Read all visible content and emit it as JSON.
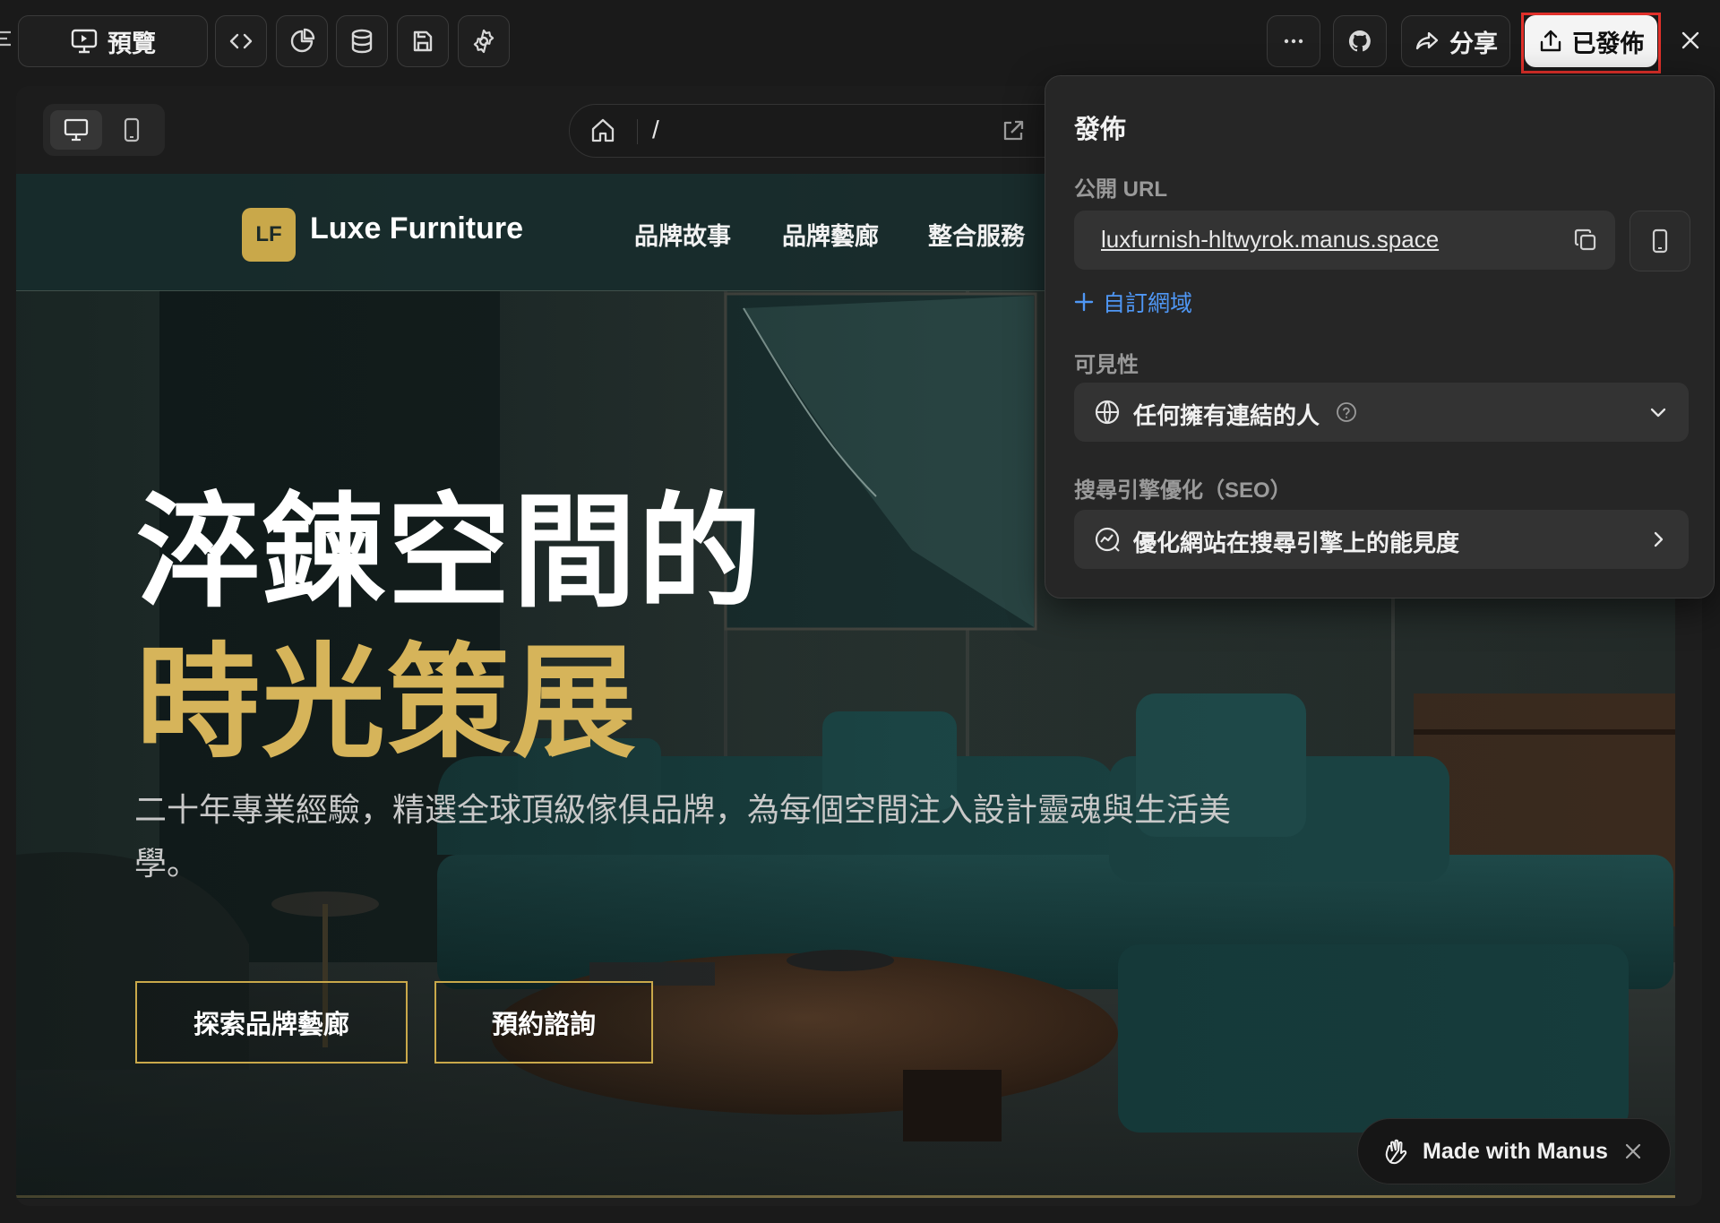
{
  "toolbar": {
    "preview_label": "預覽",
    "share_label": "分享",
    "published_label": "已發佈"
  },
  "browser": {
    "path": "/"
  },
  "site": {
    "logo": "LF",
    "brand": "Luxe Furniture",
    "nav": [
      "品牌故事",
      "品牌藝廊",
      "整合服務"
    ],
    "hero_line1": "淬鍊空間的",
    "hero_line2": "時光策展",
    "hero_sub": "二十年專業經驗，精選全球頂級傢俱品牌，為每個空間注入設計靈魂與生活美學。",
    "cta_primary": "探索品牌藝廊",
    "cta_secondary": "預約諮詢",
    "accent_color": "#c9a84a"
  },
  "badge": {
    "label": "Made with Manus"
  },
  "publish_popover": {
    "title": "發佈",
    "public_url_label": "公開 URL",
    "url": "luxfurnish-hltwyrok.manus.space",
    "custom_domain": "自訂網域",
    "visibility_label": "可見性",
    "visibility_value": "任何擁有連結的人",
    "seo_label": "搜尋引擎優化（SEO）",
    "seo_value": "優化網站在搜尋引擎上的能見度"
  }
}
